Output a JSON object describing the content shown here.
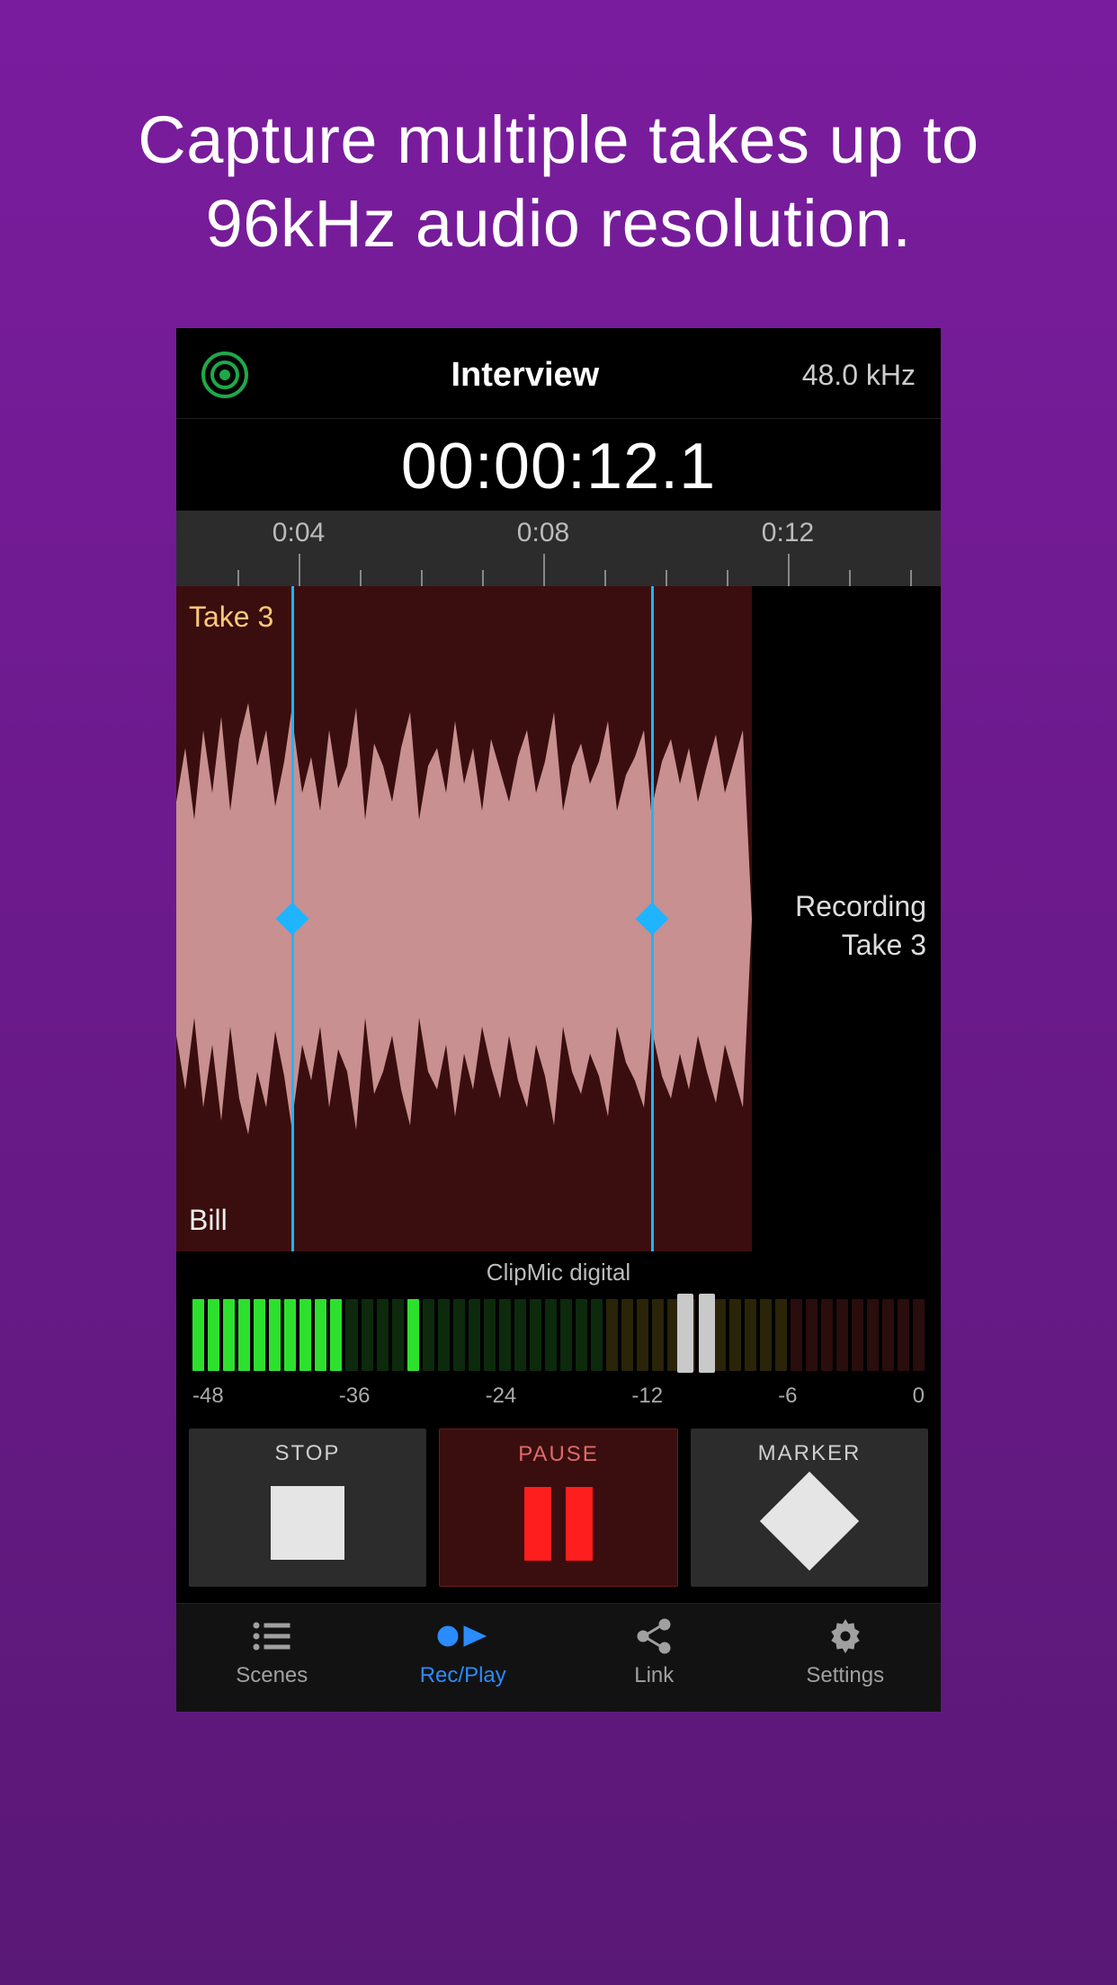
{
  "headline": "Capture multiple takes up to 96kHz audio resolution.",
  "header": {
    "title": "Interview",
    "sample_rate": "48.0 kHz"
  },
  "timecode": "00:00:12.1",
  "ruler": {
    "labels": [
      "0:04",
      "0:08",
      "0:12"
    ]
  },
  "waveform": {
    "take_label": "Take 3",
    "name_label": "Bill",
    "status_line1": "Recording",
    "status_line2": "Take 3"
  },
  "device": "ClipMic digital",
  "meter": {
    "scale": [
      "-48",
      "-36",
      "-24",
      "-12",
      "-6",
      "0"
    ]
  },
  "transport": {
    "stop_label": "STOP",
    "pause_label": "PAUSE",
    "marker_label": "MARKER"
  },
  "tabs": [
    {
      "label": "Scenes",
      "active": false
    },
    {
      "label": "Rec/Play",
      "active": true
    },
    {
      "label": "Link",
      "active": false
    },
    {
      "label": "Settings",
      "active": false
    }
  ]
}
